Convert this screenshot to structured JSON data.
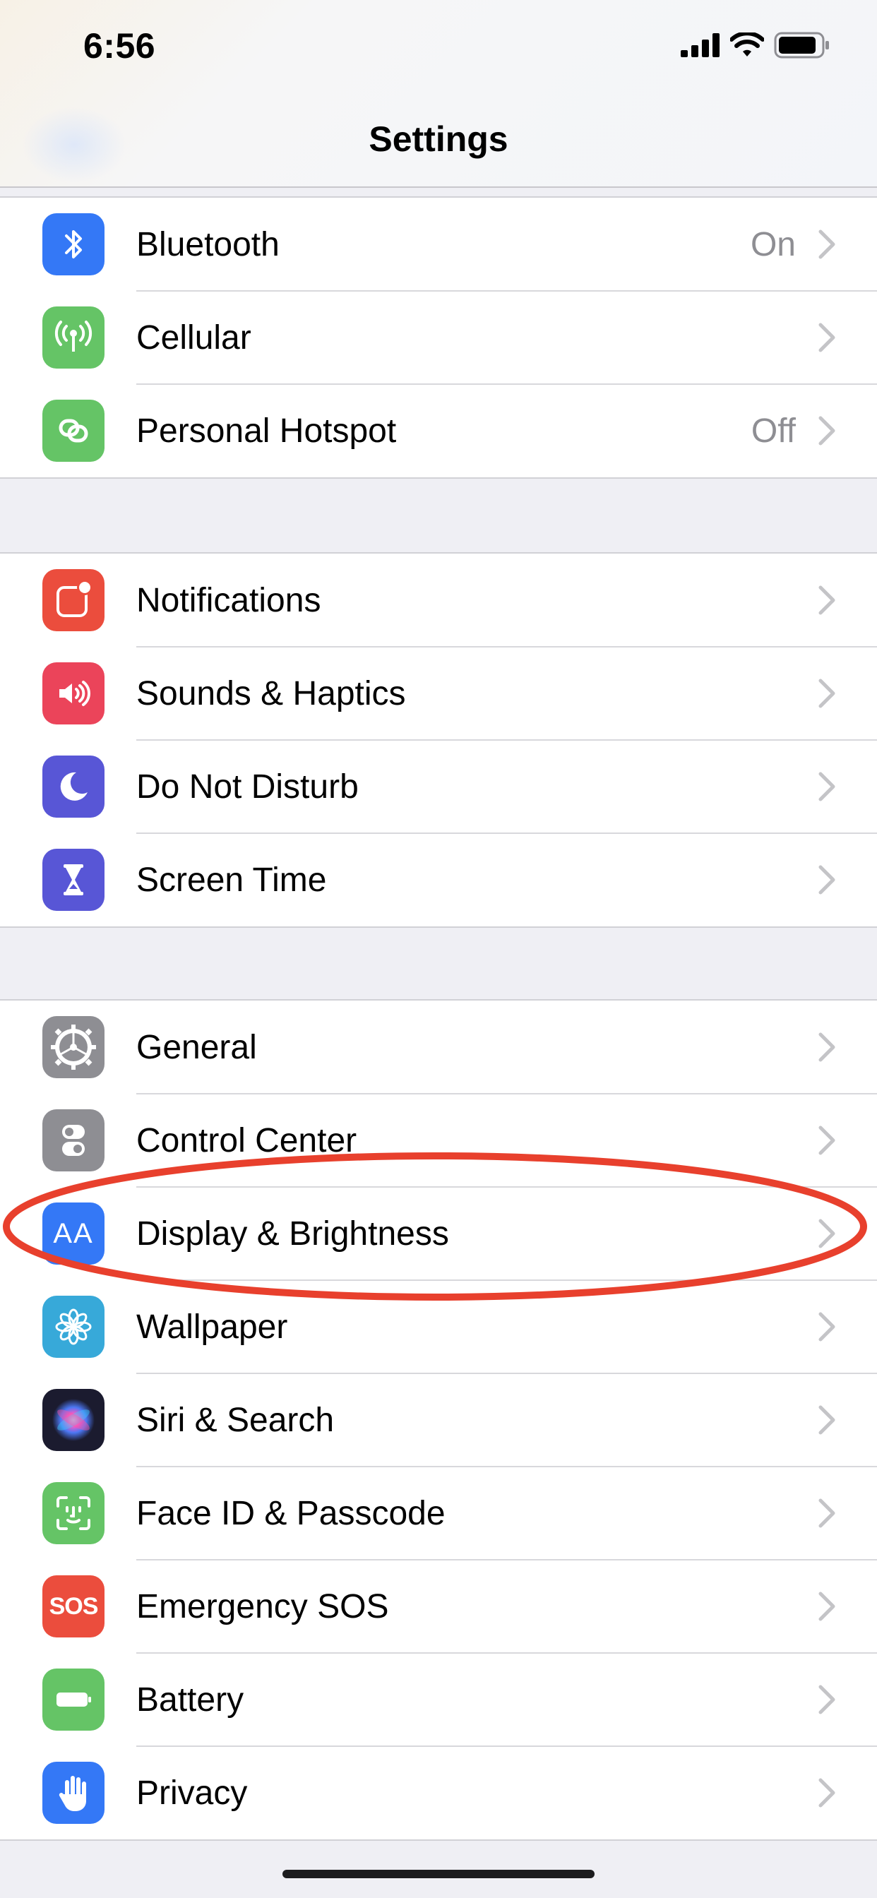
{
  "status_bar": {
    "time": "6:56"
  },
  "nav": {
    "title": "Settings"
  },
  "groups": [
    {
      "rows": [
        {
          "label": "Bluetooth",
          "value": "On",
          "icon": "bluetooth-icon",
          "color": "#3478f6"
        },
        {
          "label": "Cellular",
          "value": "",
          "icon": "cellular-icon",
          "color": "#65c466"
        },
        {
          "label": "Personal Hotspot",
          "value": "Off",
          "icon": "hotspot-icon",
          "color": "#65c466"
        }
      ]
    },
    {
      "rows": [
        {
          "label": "Notifications",
          "icon": "notifications-icon",
          "color": "#eb4d3d"
        },
        {
          "label": "Sounds & Haptics",
          "icon": "speaker-icon",
          "color": "#eb445a"
        },
        {
          "label": "Do Not Disturb",
          "icon": "moon-icon",
          "color": "#5856d6"
        },
        {
          "label": "Screen Time",
          "icon": "hourglass-icon",
          "color": "#5856d6"
        }
      ]
    },
    {
      "rows": [
        {
          "label": "General",
          "icon": "gear-icon",
          "color": "#8e8e93"
        },
        {
          "label": "Control Center",
          "icon": "toggles-icon",
          "color": "#8e8e93"
        },
        {
          "label": "Display & Brightness",
          "icon": "text-size-icon",
          "icon_text": "AA",
          "color": "#3478f6"
        },
        {
          "label": "Wallpaper",
          "icon": "flower-icon",
          "color": "#37a9d9"
        },
        {
          "label": "Siri & Search",
          "icon": "siri-icon",
          "color": "#1b1b2f"
        },
        {
          "label": "Face ID & Passcode",
          "icon": "face-id-icon",
          "color": "#65c466"
        },
        {
          "label": "Emergency SOS",
          "icon": "sos-icon",
          "icon_text": "SOS",
          "color": "#eb4d3d"
        },
        {
          "label": "Battery",
          "icon": "battery-icon",
          "color": "#65c466"
        },
        {
          "label": "Privacy",
          "icon": "hand-icon",
          "color": "#3478f6"
        }
      ]
    }
  ],
  "annotation": {
    "highlighted_row": "Display & Brightness",
    "color": "#e8402d"
  }
}
